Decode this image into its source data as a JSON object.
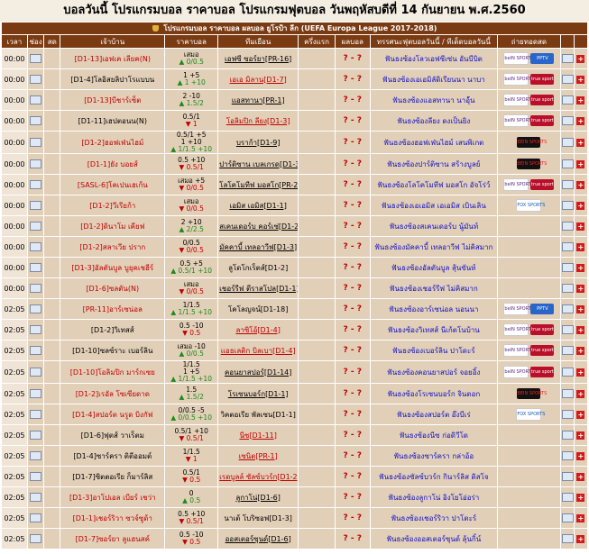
{
  "title": "บอลวันนี้ โปรแกรมบอล ราคาบอล โปรแกรมฟุตบอล วันพฤหัสบดีที่ 14 กันยายน พ.ศ.2560",
  "league": "โปรแกรมบอล ราคาบอล ผลบอล ยูโรป้า ลีก (UEFA Europa League 2017-2018)",
  "headers": [
    "เวลา",
    "ช่อง",
    "สด",
    "เจ้าบ้าน",
    "ราคาบอล",
    "ทีมเยือน",
    "ครึ่งแรก",
    "ผลบอล",
    "ทรรศนะฟุตบอลวันนี้ / ทีเด็ดบอลวันนี้",
    "ถ่ายทอดสด",
    "",
    ""
  ],
  "matches": [
    {
      "time": "00:00",
      "home": "[D1-13]เอฟเค เลียค(N)",
      "home_red": true,
      "odds": [
        "เสมอ",
        "▲ 0/0.5"
      ],
      "away": "เอฟซี ซอร์ยา[PR-16]",
      "away_red": false,
      "score": "? - ?",
      "tip": "ฟันธงซ้องโลวเอฟซีเซ่น อันบีบิต",
      "tv": [
        "bein",
        "pptv"
      ]
    },
    {
      "time": "00:00",
      "home": "[D1-4]โลอิสยลิปาโรแบบน",
      "home_red": false,
      "odds": [
        "1 +5",
        "▲ 1 +10"
      ],
      "away": "เอเอ มิลาน[D1-7]",
      "away_red": true,
      "score": "? - ?",
      "tip": "ฟันธงซ้องเอเอมิลัดิเรียนนา นาบา",
      "tv": [
        "bein",
        "true"
      ]
    },
    {
      "time": "00:00",
      "home": "[D1-13]บีชาร์เซ็ต",
      "home_red": true,
      "odds": [
        "2 -10",
        "▲ 1.5/2"
      ],
      "away": "แอสทานา[PR-1]",
      "away_red": false,
      "score": "? - ?",
      "tip": "ฟันธงซ้องแอสทานา นาอ์ุ้น",
      "tv": [
        "bein",
        "true"
      ]
    },
    {
      "time": "00:00",
      "home": "[D1-11]เฮปตอนน(N)",
      "home_red": false,
      "odds": [
        "0.5/1",
        "▼ 1"
      ],
      "away": "โอลิมปิก ลียง[D1-3]",
      "away_red": true,
      "score": "? - ?",
      "tip": "ฟันธงซ้องลียง ดงเป็นยิง",
      "tv": [
        "bein",
        "true"
      ]
    },
    {
      "time": "00:00",
      "home": "[D1-2]ฮอฟเฟ่นไฮม์",
      "home_red": true,
      "odds": [
        "0.5/1 +5",
        "1 +10",
        "▲ 1/1.5 +10"
      ],
      "away": "บราก้า[D1-9]",
      "away_red": false,
      "score": "? - ?",
      "tip": "ฟันธงซ้องฮอฟเฟ่นไฮม์ เสนพิเกต",
      "tv": [
        "red"
      ]
    },
    {
      "time": "00:00",
      "home": "[D1-1]ยัง บอยส์",
      "home_red": true,
      "odds": [
        "0.5 +10",
        "▼ 0.5/1"
      ],
      "away": "ปาร์ติซาน เบลเกรด[D1-3]",
      "away_red": false,
      "score": "? - ?",
      "tip": "ฟันธงซ้องปาร์ติซาน สร้างบูลย์",
      "tv": [
        "red"
      ]
    },
    {
      "time": "00:00",
      "home": "[SASL-6]โคเปนเฮเก้น",
      "home_red": true,
      "odds": [
        "เสมอ +5",
        "▼ 0/0.5"
      ],
      "away": "โลโคโมทีฟ มอสโก[PR-2]",
      "away_red": false,
      "score": "? - ?",
      "tip": "ฟันธงซ้องโลโคโมทีฟ มอสโก อัจโร่ว์",
      "tv": [
        "bein",
        "true"
      ]
    },
    {
      "time": "00:00",
      "home": "[D1-2]วีเรียก้า",
      "home_red": true,
      "odds": [
        "เสมอ",
        "▼ 0/0.5"
      ],
      "away": "เอมิส เอมิส[D1-1]",
      "away_red": false,
      "score": "? - ?",
      "tip": "ฟันธงซ้องเอเอมิส เอเอมิส เบินเลิน",
      "tv": [
        "fs"
      ]
    },
    {
      "time": "00:00",
      "home": "[D1-2]ดินาโม เคียฟ",
      "home_red": true,
      "odds": [
        "2 +10",
        "▲ 2/2.5"
      ],
      "away": "สเคนเดอร์บ คอร์เซ่[D1-2]",
      "away_red": false,
      "score": "? - ?",
      "tip": "ฟันธงซ้องสเคนเดอร์บ นู้มันท์",
      "tv": [
        "none"
      ]
    },
    {
      "time": "00:00",
      "home": "[D1-2]สลาเวีย ปราก",
      "home_red": true,
      "odds": [
        "0/0.5",
        "▼ 0/0.5"
      ],
      "away": "มัคคาบี้ เทลอาวีฟ[D1-3]",
      "away_red": false,
      "score": "? - ?",
      "tip": "ฟันธงซ้องมัคคาบี้ เทลอาวีฟ ไม่คิสมาก",
      "tv": [
        "none"
      ]
    },
    {
      "time": "00:00",
      "home": "[D1-3]อัลตันบูล บูยุคเชฮีร์",
      "home_red": true,
      "odds": [
        "0.5 +5",
        "▲ 0.5/1 +10"
      ],
      "away": "ลูโดโกเร็ตส์[D1-2]",
      "away_red": false,
      "away_plain": true,
      "score": "? - ?",
      "tip": "ฟันธงซ้องอัลตันบูล สุ้นขันท์",
      "tv": [
        "none"
      ]
    },
    {
      "time": "00:00",
      "home": "[D1-6]ซลตัน(N)",
      "home_red": true,
      "odds": [
        "เสมอ",
        "▼ 0/0.5"
      ],
      "away": "เชอร์รีฟ ตีราสโปล[D1-1]",
      "away_red": false,
      "score": "? - ?",
      "tip": "ฟันธงซ้องเชอร์รีฟ ไม่คิสมาก",
      "tv": [
        "none"
      ]
    },
    {
      "time": "02:05",
      "home": "[PR-11]อาร์เซน่อล",
      "home_red": true,
      "odds": [
        "1/1.5",
        "▲ 1/1.5 +10"
      ],
      "away": "โคโลญจน์[D1-18]",
      "away_red": false,
      "away_plain": true,
      "score": "? - ?",
      "tip": "ฟันธงซ้องอาร์เซน่อล นอนนา",
      "tv": [
        "bein",
        "pptv"
      ]
    },
    {
      "time": "02:05",
      "home": "[D1-2]วิเทสส์",
      "home_red": false,
      "odds": [
        "0.5 -10",
        "▼ 0.5"
      ],
      "away": "ลาซิโอ้[D1-4]",
      "away_red": true,
      "score": "? - ?",
      "tip": "ฟันธงซ้องวิเทสส์ นีเก้ตโนบ้าน",
      "tv": [
        "bein",
        "true"
      ]
    },
    {
      "time": "02:05",
      "home": "[D1-10]ซลซ์ราะ เบอร์ลิน",
      "home_red": false,
      "odds": [
        "เสมอ -10",
        "▲ 0/0.5"
      ],
      "away": "แอธเลติก บิลเบา[D1-4]",
      "away_red": true,
      "score": "? - ?",
      "tip": "ฟันธงซ้องเบอร์ลิน ปาโดะร์",
      "tv": [
        "bein",
        "true"
      ]
    },
    {
      "time": "02:05",
      "home": "[D1-10]โอลิมปิก มาร์กเซย",
      "home_red": true,
      "odds": [
        "1/1.5",
        "1 +5",
        "▲ 1/1.5 +10"
      ],
      "away": "คอนยาสปอร์[D1-14]",
      "away_red": false,
      "score": "? - ?",
      "tip": "ฟันธงซ้องคอนยาสปอร์ จอยอิ้ง",
      "tv": [
        "bein",
        "true"
      ]
    },
    {
      "time": "02:05",
      "home": "[D1-2]เรอัล โซเซียดาด",
      "home_red": true,
      "odds": [
        "1.5",
        "▲ 1.5/2"
      ],
      "away": "โรเซนบอร์ก[D1-1]",
      "away_red": false,
      "score": "? - ?",
      "tip": "ฟันธงซ้องโรเซนบอร์ก จินดอก",
      "tv": [
        "red"
      ]
    },
    {
      "time": "02:05",
      "home": "[D1-4]สปอร์ต นรูด บิงกัฟ",
      "home_red": true,
      "odds": [
        "0/0.5 -5",
        "▲ 0/0.5 +10"
      ],
      "away": "วิคตอเรีย พัลเซน[D1-1]",
      "away_red": false,
      "away_plain": true,
      "score": "? - ?",
      "tip": "ฟันธงซ้องสปอร์ต อ๊งบีเร่",
      "tv": [
        "fs"
      ]
    },
    {
      "time": "02:05",
      "home": "[D1-6]ฟุตส์ วาเร็ตม",
      "home_red": false,
      "odds": [
        "0.5/1 +10",
        "▼ 0.5/1"
      ],
      "away": "นีซ[D1-11]",
      "away_red": true,
      "score": "? - ?",
      "tip": "ฟันธงซ้องนีซ ก่อดิวีโด",
      "tv": [
        "none"
      ]
    },
    {
      "time": "02:05",
      "home": "[D1-4]ซาร์ครา ติตีออมต์",
      "home_red": false,
      "odds": [
        "1/1.5",
        "▼ 1"
      ],
      "away": "เซนิต[PR-1]",
      "away_red": true,
      "score": "? - ?",
      "tip": "ฟันธงซ้องซาร์ครา กล่าอ้อ",
      "tv": [
        "none"
      ]
    },
    {
      "time": "02:05",
      "home": "[D1-7]ซิตตอเรีย ก็มาร์ลิส",
      "home_red": false,
      "odds": [
        "0.5/1",
        "▼ 0.5"
      ],
      "away": "เรดบูลล์ ซัลซ์บวร์ก[D1-2]",
      "away_red": true,
      "score": "? - ?",
      "tip": "ฟันธงซ้องซัลซ์บวร์ก กินาร์ลิส ดิสโจ",
      "tv": [
        "none"
      ]
    },
    {
      "time": "02:05",
      "home": "[D1-3]อาโปเอล เบียร์ เชว่า",
      "home_red": true,
      "odds": [
        "0",
        "▲ 0.5"
      ],
      "away": "ลูกาโน่[D1-6]",
      "away_red": false,
      "score": "? - ?",
      "tip": "ฟันธงซ้องลูกาโน่ อิงโยโอ่อร่า",
      "tv": [
        "none"
      ]
    },
    {
      "time": "02:05",
      "home": "[D1-1]เชอร์ริวา ซวจ์ซูด้า",
      "home_red": true,
      "odds": [
        "0.5 +10",
        "▼ 0.5/1"
      ],
      "away": "นาเต้ โบริซอฟ[D1-3]",
      "away_red": false,
      "away_plain": true,
      "score": "? - ?",
      "tip": "ฟันธงซ้องเชอร์ริวา ปาโดะร์",
      "tv": [
        "none"
      ]
    },
    {
      "time": "02:05",
      "home": "[D1-7]ซอร์ยา ลูแฮนสค์",
      "home_red": true,
      "odds": [
        "0.5 -10",
        "▼ 0.5"
      ],
      "away": "ออสเตอร์ซุนด์[D1-6]",
      "away_red": false,
      "score": "? - ?",
      "tip": "ฟันธงซ้องออสเตอร์ซุนด์ ลุ้นกิ้น์",
      "tv": [
        "none"
      ]
    }
  ],
  "tv_labels": {
    "bein": "beIN SPORTS",
    "pptv": "PPTV",
    "true": "true sport",
    "red": "BEIN SPORTS",
    "fs": "FOX SPORTS"
  },
  "icons": {
    "live": "live-icon",
    "stat": "stat-icon",
    "plus": "+"
  },
  "colors": {
    "header_bg": "#7a3a12",
    "row_bg": "#e2cfb8",
    "home_red": "#c00000",
    "tip": "#1010c0",
    "up": "#1a8a1a",
    "down": "#c00000"
  }
}
